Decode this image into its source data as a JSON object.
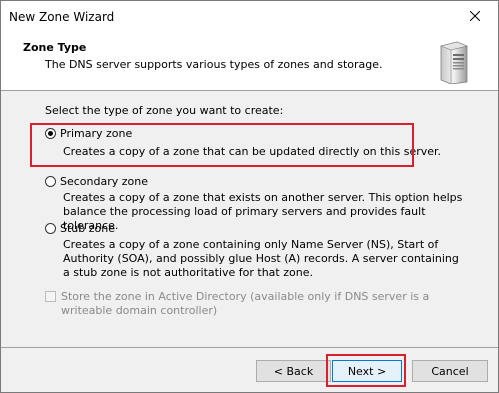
{
  "window": {
    "title": "New Zone Wizard"
  },
  "header": {
    "title": "Zone Type",
    "subtitle": "The DNS server supports various types of zones and storage."
  },
  "content": {
    "prompt": "Select the type of zone you want to create:",
    "options": [
      {
        "label": "Primary zone",
        "selected": true,
        "description": "Creates a copy of a zone that can be updated directly on this server."
      },
      {
        "label": "Secondary zone",
        "selected": false,
        "description": "Creates a copy of a zone that exists on another server. This option helps balance the processing load of primary servers and provides fault tolerance."
      },
      {
        "label": "Stub zone",
        "selected": false,
        "description": "Creates a copy of a zone containing only Name Server (NS), Start of Authority (SOA), and possibly glue Host (A) records. A server containing a stub zone is not authoritative for that zone."
      }
    ],
    "ad_checkbox": {
      "label": "Store the zone in Active Directory (available only if DNS server is a writeable domain controller)",
      "checked": false,
      "enabled": false
    }
  },
  "buttons": {
    "back": "< Back",
    "next": "Next >",
    "cancel": "Cancel"
  },
  "colors": {
    "highlight": "#d9202e",
    "focus": "#0078d7"
  },
  "icons": {
    "close": "close-icon",
    "header": "server-icon"
  }
}
